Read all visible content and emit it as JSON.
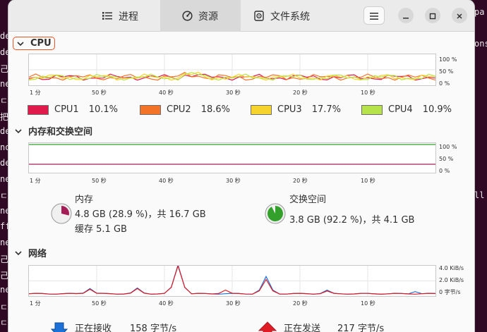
{
  "background_terminal": {
    "left_fragments": [
      "de",
      "de",
      "己/",
      "ne",
      "ㄷ",
      "把",
      "de",
      "no",
      "de",
      "ne",
      "ㄷ",
      "ne",
      "ff",
      "ne",
      "己/",
      "己/",
      "ne",
      "ㄷ",
      "ㄷ"
    ],
    "right_fragments": [
      "pa",
      "ons",
      "ll"
    ]
  },
  "header": {
    "tabs": [
      {
        "label": "进程",
        "icon": "list-icon"
      },
      {
        "label": "资源",
        "icon": "gauge-icon"
      },
      {
        "label": "文件系统",
        "icon": "disk-icon"
      }
    ],
    "active_tab": 1
  },
  "cpu": {
    "title": "CPU",
    "y_labels": [
      "100 %",
      "50 %",
      "0 %"
    ],
    "x_labels": [
      "1 分",
      "50 秒",
      "40 秒",
      "30 秒",
      "20 秒",
      "10 秒"
    ],
    "legend": [
      {
        "name": "CPU1",
        "value": "10.1%",
        "color": "#e01b4c"
      },
      {
        "name": "CPU2",
        "value": "18.6%",
        "color": "#f37329"
      },
      {
        "name": "CPU3",
        "value": "17.7%",
        "color": "#f6d32d"
      },
      {
        "name": "CPU4",
        "value": "10.9%",
        "color": "#b6e34a"
      }
    ]
  },
  "memory": {
    "title": "内存和交换空间",
    "y_labels": [
      "100 %",
      "50 %",
      "0 %"
    ],
    "x_labels": [
      "1 分",
      "50 秒",
      "40 秒",
      "30 秒",
      "20 秒",
      "10 秒"
    ],
    "ram_label": "内存",
    "ram_usage": "4.8 GB (28.9 %)，共 16.7 GB",
    "ram_cache": "缓存 5.1 GB",
    "ram_fraction": 0.289,
    "ram_color": "#a51d56",
    "swap_label": "交换空间",
    "swap_usage": "3.8 GB (92.2 %)，共 4.1 GB",
    "swap_fraction": 0.922,
    "swap_color": "#33a02c"
  },
  "network": {
    "title": "网络",
    "y_labels": [
      "4.0 KiB/s",
      "2.0 KiB/s",
      "0 字节/s"
    ],
    "x_labels": [
      "1 分",
      "50 秒",
      "40 秒",
      "30 秒",
      "20 秒",
      "10 秒"
    ],
    "receiving_label": "正在接收",
    "receiving_value": "158 字节/s",
    "sending_label": "正在发送",
    "sending_value": "217 字节/s",
    "receive_color": "#1c71d8",
    "send_color": "#e01b24"
  }
}
